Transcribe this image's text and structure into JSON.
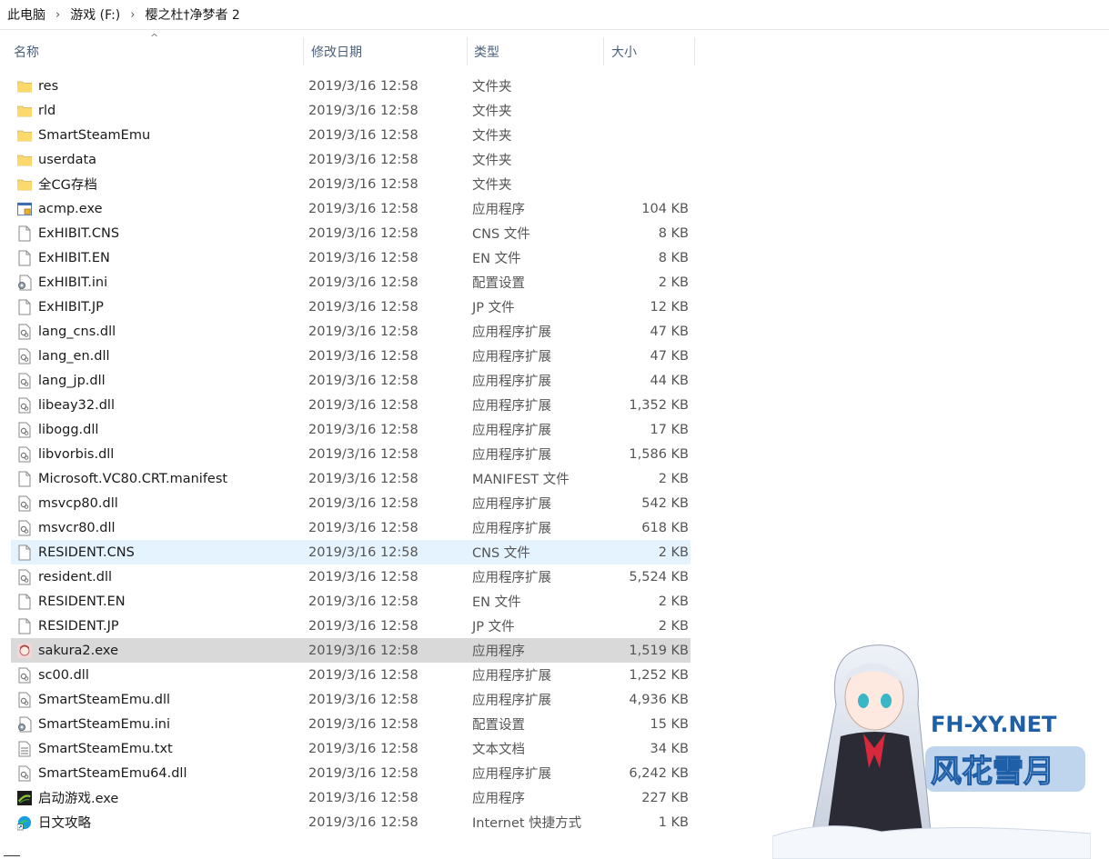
{
  "breadcrumb": [
    "此电脑",
    "游戏 (F:)",
    "樱之杜†净梦者 2"
  ],
  "breadcrumb_separator": "›",
  "columns": {
    "name": "名称",
    "date": "修改日期",
    "type": "类型",
    "size": "大小",
    "sort_indicator": "^"
  },
  "files": [
    {
      "name": "res",
      "date": "2019/3/16 12:58",
      "type": "文件夹",
      "size": "",
      "icon": "folder-icon"
    },
    {
      "name": "rld",
      "date": "2019/3/16 12:58",
      "type": "文件夹",
      "size": "",
      "icon": "folder-icon"
    },
    {
      "name": "SmartSteamEmu",
      "date": "2019/3/16 12:58",
      "type": "文件夹",
      "size": "",
      "icon": "folder-icon"
    },
    {
      "name": "userdata",
      "date": "2019/3/16 12:58",
      "type": "文件夹",
      "size": "",
      "icon": "folder-icon"
    },
    {
      "name": "全CG存档",
      "date": "2019/3/16 12:58",
      "type": "文件夹",
      "size": "",
      "icon": "folder-icon"
    },
    {
      "name": "acmp.exe",
      "date": "2019/3/16 12:58",
      "type": "应用程序",
      "size": "104 KB",
      "icon": "exe-icon"
    },
    {
      "name": "ExHIBIT.CNS",
      "date": "2019/3/16 12:58",
      "type": "CNS 文件",
      "size": "8 KB",
      "icon": "file-icon"
    },
    {
      "name": "ExHIBIT.EN",
      "date": "2019/3/16 12:58",
      "type": "EN 文件",
      "size": "8 KB",
      "icon": "file-icon"
    },
    {
      "name": "ExHIBIT.ini",
      "date": "2019/3/16 12:58",
      "type": "配置设置",
      "size": "2 KB",
      "icon": "ini-icon"
    },
    {
      "name": "ExHIBIT.JP",
      "date": "2019/3/16 12:58",
      "type": "JP 文件",
      "size": "12 KB",
      "icon": "file-icon"
    },
    {
      "name": "lang_cns.dll",
      "date": "2019/3/16 12:58",
      "type": "应用程序扩展",
      "size": "47 KB",
      "icon": "dll-icon"
    },
    {
      "name": "lang_en.dll",
      "date": "2019/3/16 12:58",
      "type": "应用程序扩展",
      "size": "47 KB",
      "icon": "dll-icon"
    },
    {
      "name": "lang_jp.dll",
      "date": "2019/3/16 12:58",
      "type": "应用程序扩展",
      "size": "44 KB",
      "icon": "dll-icon"
    },
    {
      "name": "libeay32.dll",
      "date": "2019/3/16 12:58",
      "type": "应用程序扩展",
      "size": "1,352 KB",
      "icon": "dll-icon"
    },
    {
      "name": "libogg.dll",
      "date": "2019/3/16 12:58",
      "type": "应用程序扩展",
      "size": "17 KB",
      "icon": "dll-icon"
    },
    {
      "name": "libvorbis.dll",
      "date": "2019/3/16 12:58",
      "type": "应用程序扩展",
      "size": "1,586 KB",
      "icon": "dll-icon"
    },
    {
      "name": "Microsoft.VC80.CRT.manifest",
      "date": "2019/3/16 12:58",
      "type": "MANIFEST 文件",
      "size": "2 KB",
      "icon": "file-icon"
    },
    {
      "name": "msvcp80.dll",
      "date": "2019/3/16 12:58",
      "type": "应用程序扩展",
      "size": "542 KB",
      "icon": "dll-icon"
    },
    {
      "name": "msvcr80.dll",
      "date": "2019/3/16 12:58",
      "type": "应用程序扩展",
      "size": "618 KB",
      "icon": "dll-icon"
    },
    {
      "name": "RESIDENT.CNS",
      "date": "2019/3/16 12:58",
      "type": "CNS 文件",
      "size": "2 KB",
      "icon": "file-icon",
      "state": "hover"
    },
    {
      "name": "resident.dll",
      "date": "2019/3/16 12:58",
      "type": "应用程序扩展",
      "size": "5,524 KB",
      "icon": "dll-icon"
    },
    {
      "name": "RESIDENT.EN",
      "date": "2019/3/16 12:58",
      "type": "EN 文件",
      "size": "2 KB",
      "icon": "file-icon"
    },
    {
      "name": "RESIDENT.JP",
      "date": "2019/3/16 12:58",
      "type": "JP 文件",
      "size": "2 KB",
      "icon": "file-icon"
    },
    {
      "name": "sakura2.exe",
      "date": "2019/3/16 12:58",
      "type": "应用程序",
      "size": "1,519 KB",
      "icon": "game-exe-icon",
      "state": "selected"
    },
    {
      "name": "sc00.dll",
      "date": "2019/3/16 12:58",
      "type": "应用程序扩展",
      "size": "1,252 KB",
      "icon": "dll-icon"
    },
    {
      "name": "SmartSteamEmu.dll",
      "date": "2019/3/16 12:58",
      "type": "应用程序扩展",
      "size": "4,936 KB",
      "icon": "dll-icon"
    },
    {
      "name": "SmartSteamEmu.ini",
      "date": "2019/3/16 12:58",
      "type": "配置设置",
      "size": "15 KB",
      "icon": "ini-icon"
    },
    {
      "name": "SmartSteamEmu.txt",
      "date": "2019/3/16 12:58",
      "type": "文本文档",
      "size": "34 KB",
      "icon": "text-icon"
    },
    {
      "name": "SmartSteamEmu64.dll",
      "date": "2019/3/16 12:58",
      "type": "应用程序扩展",
      "size": "6,242 KB",
      "icon": "dll-icon"
    },
    {
      "name": "启动游戏.exe",
      "date": "2019/3/16 12:58",
      "type": "应用程序",
      "size": "227 KB",
      "icon": "launcher-exe-icon"
    },
    {
      "name": "日文攻略",
      "date": "2019/3/16 12:58",
      "type": "Internet 快捷方式",
      "size": "1 KB",
      "icon": "edge-shortcut-icon"
    }
  ],
  "watermark": {
    "url_text": "FH-XY.NET",
    "logo_text": "风花雪月"
  },
  "colors": {
    "hover": "#e5f3ff",
    "selected": "#d9d9d9",
    "folder": "#f8d775",
    "header_text": "#4c607a",
    "watermark_blue": "#1f5fa8"
  }
}
